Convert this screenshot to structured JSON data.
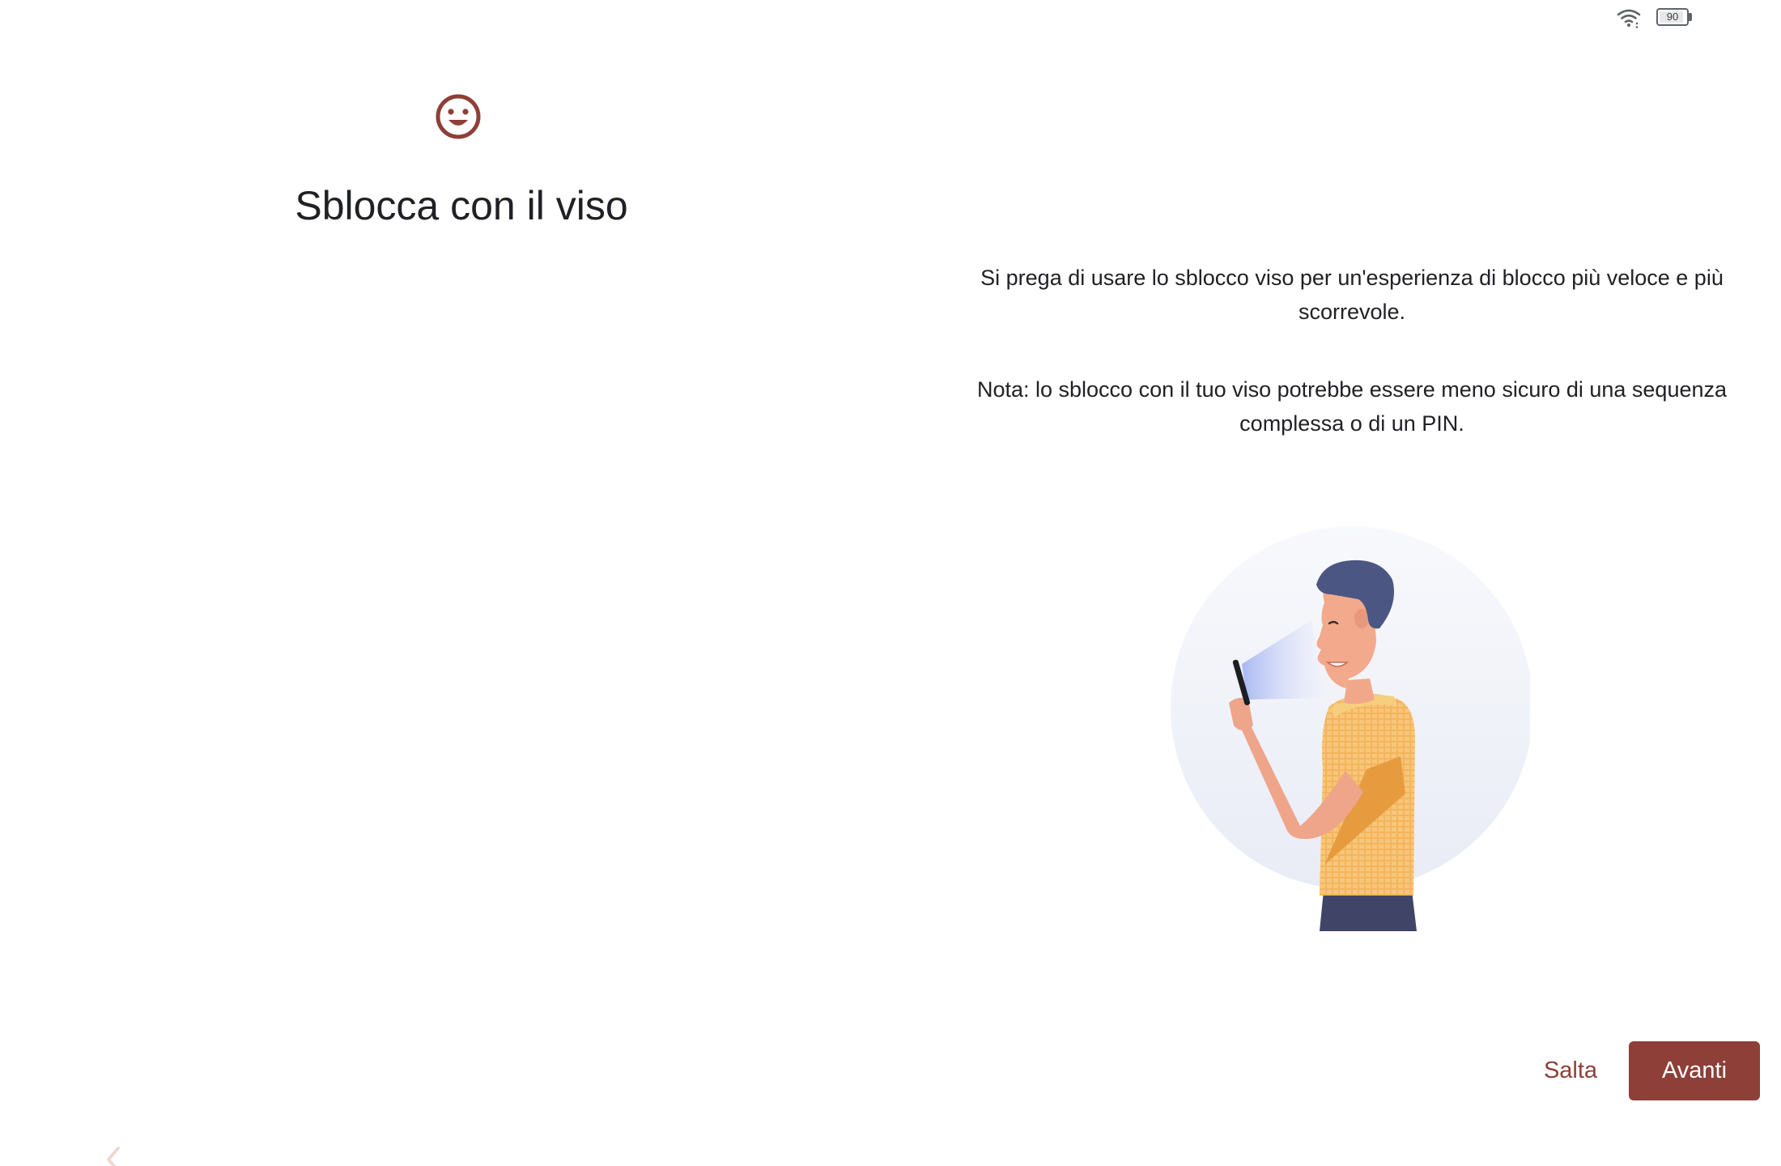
{
  "status_bar": {
    "wifi_icon": "wifi-icon",
    "battery_level": "90",
    "battery_fraction": 0.9
  },
  "header": {
    "icon": "face-icon",
    "title": "Sblocca con il viso"
  },
  "content": {
    "description": "Si prega di usare lo sblocco viso per un'esperienza di blocco più veloce e più scorrevole.",
    "note": "Nota: lo sblocco con il tuo viso potrebbe essere meno sicuro di una sequenza complessa o di un PIN.",
    "illustration": "person-face-unlock-illustration"
  },
  "footer": {
    "skip_label": "Salta",
    "next_label": "Avanti"
  },
  "navigation": {
    "back_icon": "chevron-left-icon"
  },
  "colors": {
    "accent": "#8d3f38",
    "text": "#202124",
    "background": "#ffffff"
  }
}
